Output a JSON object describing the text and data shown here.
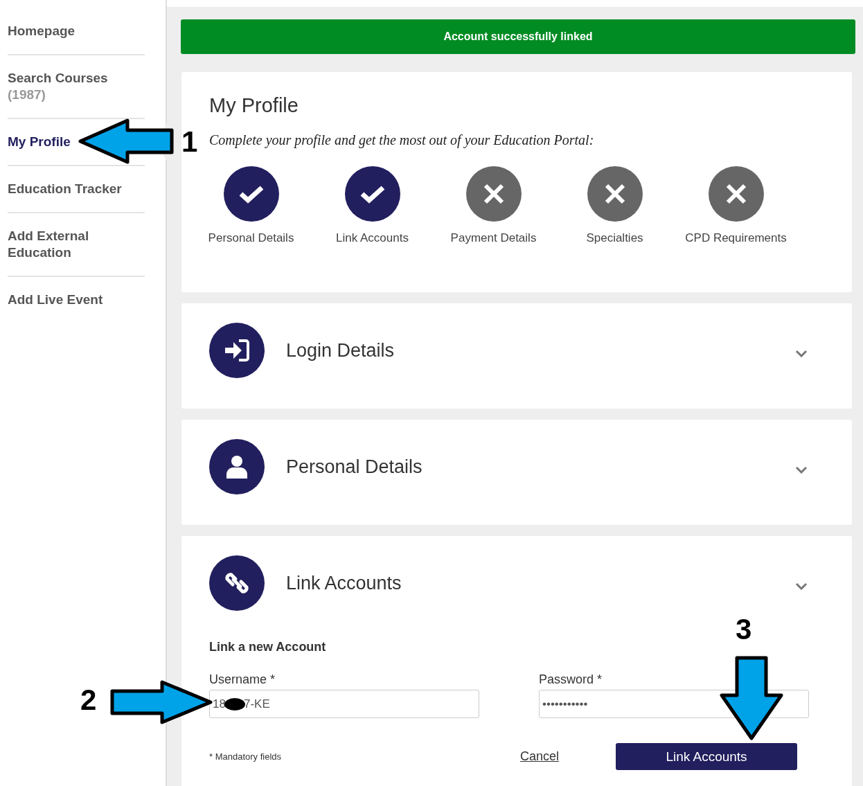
{
  "sidebar": {
    "items": [
      {
        "label": "Homepage",
        "selected": false
      },
      {
        "label": "Search Courses",
        "count": "(1987)",
        "selected": false
      },
      {
        "label": "My Profile",
        "selected": true
      },
      {
        "label": "Education Tracker",
        "selected": false
      },
      {
        "label": "Add External Education",
        "selected": false
      },
      {
        "label": "Add Live Event",
        "selected": false
      }
    ]
  },
  "banner": {
    "text": "Account successfully linked"
  },
  "profile": {
    "title": "My Profile",
    "subtitle": "Complete your profile and get the most out of your Education Portal:",
    "steps": [
      {
        "label": "Personal Details",
        "done": true
      },
      {
        "label": "Link Accounts",
        "done": true
      },
      {
        "label": "Payment Details",
        "done": false
      },
      {
        "label": "Specialties",
        "done": false
      },
      {
        "label": "CPD Requirements",
        "done": false
      }
    ]
  },
  "sections": [
    {
      "title": "Login Details",
      "kind": "login"
    },
    {
      "title": "Personal Details",
      "kind": "person"
    },
    {
      "title": "Link Accounts",
      "kind": "link",
      "form": {
        "heading": "Link a new Account",
        "fields": [
          {
            "label": "Username *",
            "value": [
              "18",
              "7-KE"
            ],
            "redacted": true
          },
          {
            "label": "Password *",
            "value": [
              "•••••••••••"
            ]
          }
        ],
        "note": "* Mandatory fields",
        "cancel": "Cancel",
        "submit": "Link Accounts"
      }
    }
  ],
  "annotations": [
    {
      "number": "1",
      "kind": "left"
    },
    {
      "number": "2",
      "kind": "right"
    },
    {
      "number": "3",
      "kind": "down"
    }
  ]
}
